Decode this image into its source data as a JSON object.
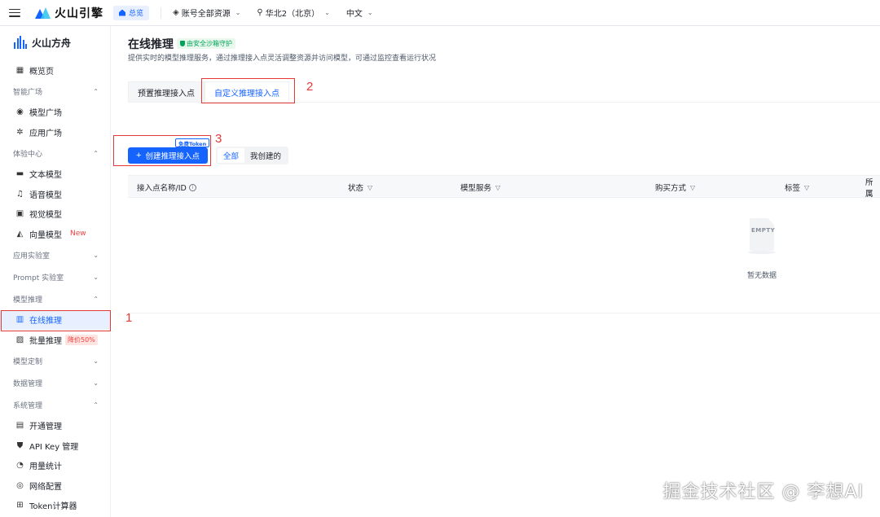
{
  "topbar": {
    "brand": "火山引擎",
    "home": "总览",
    "account_scope": "账号全部资源",
    "region": "华北2（北京）",
    "language": "中文"
  },
  "sidebar": {
    "brand": "火山方舟",
    "overview": "概览页",
    "group_smart": "智能广场",
    "model_square": "模型广场",
    "app_square": "应用广场",
    "group_experience": "体验中心",
    "text_model": "文本模型",
    "voice_model": "语音模型",
    "vision_model": "视觉模型",
    "vector_model": "向量模型",
    "vector_badge": "New",
    "group_app_lab": "应用实验室",
    "group_prompt_lab": "Prompt 实验室",
    "group_inference": "模型推理",
    "online_inference": "在线推理",
    "batch_inference": "批量推理",
    "batch_badge": "降价50%",
    "group_custom": "模型定制",
    "group_data": "数据管理",
    "group_system": "系统管理",
    "activation": "开通管理",
    "api_key": "API Key 管理",
    "usage": "用量统计",
    "network": "网络配置",
    "token_calc": "Token计算器"
  },
  "main": {
    "title": "在线推理",
    "safe_tag": "由安全沙箱守护",
    "description": "提供实时的模型推理服务，通过推理接入点灵活调整资源并访问模型，可通过监控查看运行状况",
    "tabs": [
      "预置推理接入点",
      "自定义推理接入点"
    ],
    "create_button": "创建推理接入点",
    "free_token": "免费Token",
    "filter_all": "全部",
    "filter_mine": "我创建的",
    "columns": [
      "接入点名称/ID",
      "状态",
      "模型服务",
      "购买方式",
      "标签",
      "所属"
    ],
    "empty_img_text": "EMPTY",
    "empty_text": "暂无数据"
  },
  "annotations": {
    "n1": "1",
    "n2": "2",
    "n3": "3"
  },
  "watermark": "掘金技术社区 @ 李想AI",
  "colors": {
    "primary": "#1664ff",
    "annotation_red": "#e53935",
    "safe_green": "#00a35a"
  }
}
